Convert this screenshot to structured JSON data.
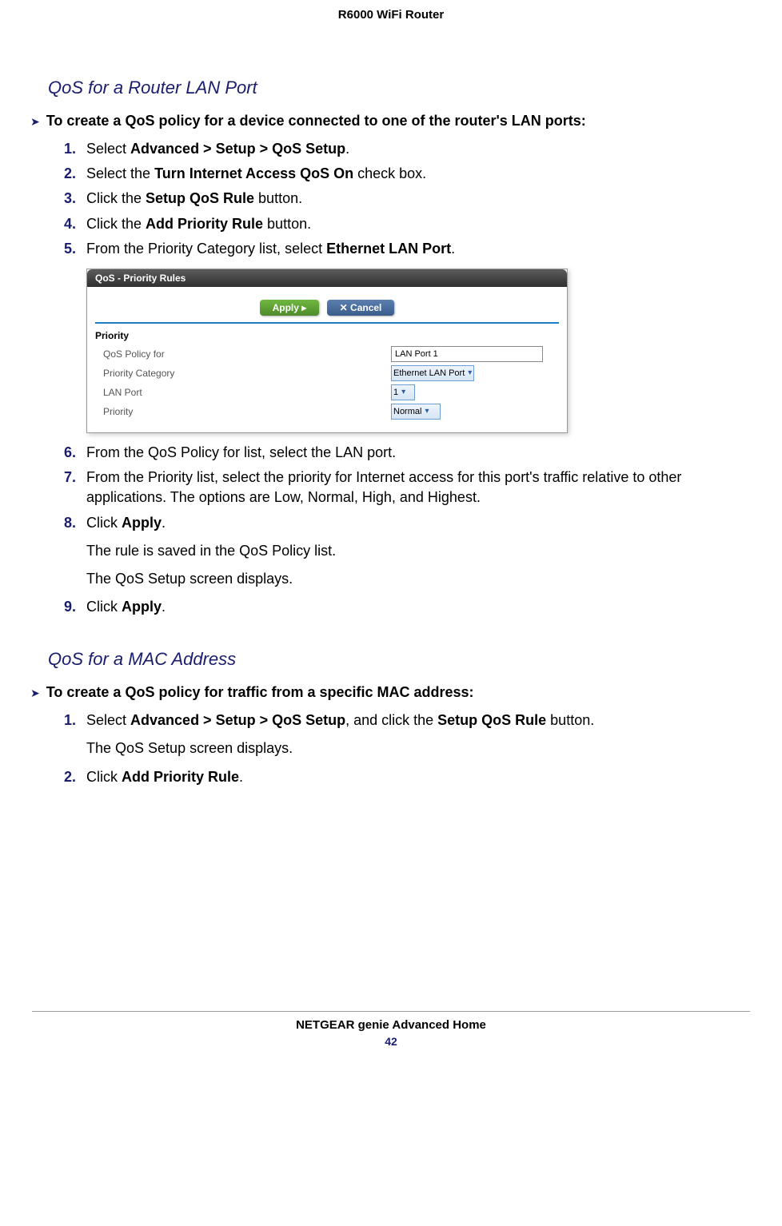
{
  "header": "R6000 WiFi Router",
  "section1": {
    "title": "QoS for a Router LAN Port",
    "lead": "To create a QoS policy for a device connected to one of the router's LAN ports:",
    "steps": [
      {
        "num": "1.",
        "pre": "Select ",
        "bold": "Advanced > Setup > QoS Setup",
        "post": "."
      },
      {
        "num": "2.",
        "pre": "Select the ",
        "bold": "Turn Internet Access QoS On",
        "post": " check box."
      },
      {
        "num": "3.",
        "pre": "Click the ",
        "bold": "Setup QoS Rule",
        "post": " button."
      },
      {
        "num": "4.",
        "pre": "Click the ",
        "bold": "Add Priority Rule",
        "post": " button."
      },
      {
        "num": "5.",
        "pre": "From the Priority Category list, select ",
        "bold": "Ethernet LAN Port",
        "post": "."
      }
    ],
    "steps_after": [
      {
        "num": "6.",
        "text": "From the QoS Policy for list, select the LAN port."
      },
      {
        "num": "7.",
        "text": "From the Priority list, select the priority for Internet access for this port's traffic relative to other applications. The options are Low, Normal, High, and Highest."
      },
      {
        "num": "8.",
        "pre": "Click ",
        "bold": "Apply",
        "post": "."
      }
    ],
    "continuations": [
      "The rule is saved in the QoS Policy list.",
      "The QoS Setup screen displays."
    ],
    "step9": {
      "num": "9.",
      "pre": "Click ",
      "bold": "Apply",
      "post": "."
    }
  },
  "screenshot": {
    "title": "QoS - Priority Rules",
    "apply": "Apply ▸",
    "cancel": "✕ Cancel",
    "section": "Priority",
    "rows": {
      "policy_for": {
        "label": "QoS Policy for",
        "value": "LAN Port 1"
      },
      "category": {
        "label": "Priority Category",
        "value": "Ethernet LAN Port"
      },
      "lan_port": {
        "label": "LAN Port",
        "value": "1"
      },
      "priority": {
        "label": "Priority",
        "value": "Normal"
      }
    }
  },
  "section2": {
    "title": "QoS for a MAC Address",
    "lead": "To create a QoS policy for traffic from a specific MAC address:",
    "steps": [
      {
        "num": "1.",
        "pre": "Select ",
        "bold": "Advanced > Setup > QoS Setup",
        "mid": ", and click the ",
        "bold2": "Setup QoS Rule",
        "post": " button."
      }
    ],
    "continuation": "The QoS Setup screen displays.",
    "step2": {
      "num": "2.",
      "pre": "Click ",
      "bold": "Add Priority Rule",
      "post": "."
    }
  },
  "footer": {
    "text": "NETGEAR genie Advanced Home",
    "page": "42"
  }
}
